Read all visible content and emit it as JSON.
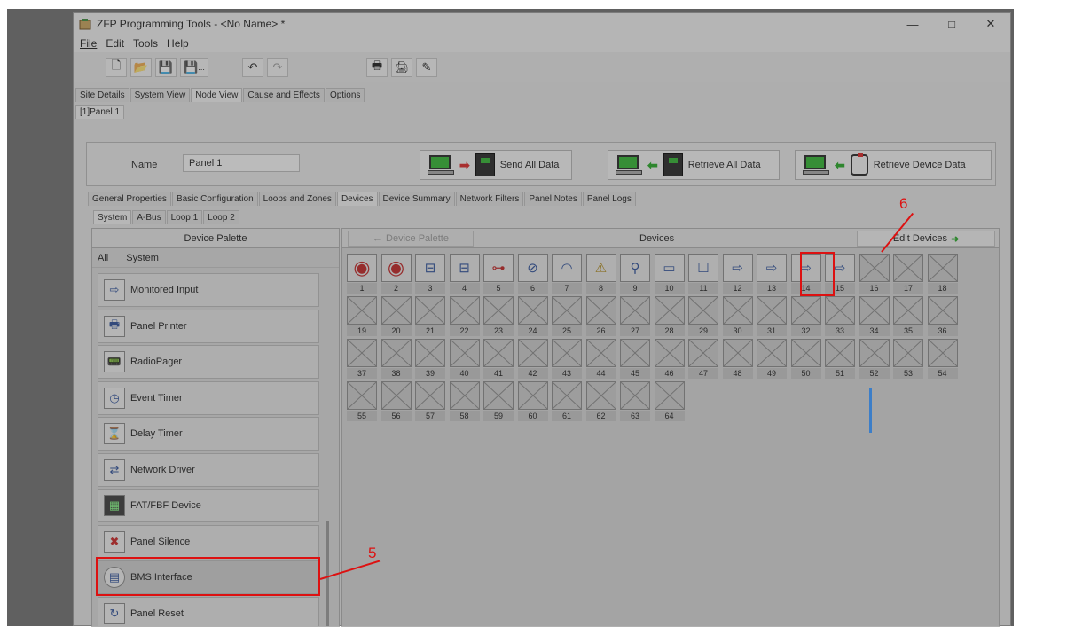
{
  "window": {
    "title": "ZFP Programming Tools - <No Name> *",
    "controls": {
      "minimize": "—",
      "maximize": "□",
      "close": "✕"
    }
  },
  "menu": [
    "File",
    "Edit",
    "Tools",
    "Help"
  ],
  "toolbar": {
    "icons": [
      "new-icon",
      "open-icon",
      "save-icon",
      "save-as-icon",
      "undo-icon",
      "redo-icon",
      "print-icon",
      "print-preview-icon",
      "print-setup-icon"
    ],
    "save_as_suffix": "..."
  },
  "main_tabs": [
    "Site Details",
    "System View",
    "Node View",
    "Cause and Effects",
    "Options"
  ],
  "node_tabs": [
    "[1]Panel 1"
  ],
  "name_bar": {
    "label": "Name",
    "value": "Panel 1",
    "send": "Send All Data",
    "retrieve_all": "Retrieve All Data",
    "retrieve_device": "Retrieve Device Data"
  },
  "sub_tabs": [
    "General Properties",
    "Basic Configuration",
    "Loops and Zones",
    "Devices",
    "Device Summary",
    "Network Filters",
    "Panel Notes",
    "Panel Logs"
  ],
  "sub_tabs2": [
    "System",
    "A-Bus",
    "Loop 1",
    "Loop 2"
  ],
  "palette": {
    "header": "Device Palette",
    "filters": [
      "All",
      "System"
    ],
    "items": [
      "Monitored Input",
      "Panel Printer",
      "RadioPager",
      "Event Timer",
      "Delay Timer",
      "Network Driver",
      "FAT/FBF Device",
      "Panel Silence",
      "BMS Interface",
      "Panel Reset"
    ]
  },
  "devices": {
    "back_label": "Device Palette",
    "title": "Devices",
    "edit_label": "Edit Devices",
    "filled": 15,
    "total": 64
  },
  "callouts": {
    "a": "6",
    "b": "5"
  },
  "colors": {
    "highlight": "#d11111",
    "accent_green": "#2fb62f"
  }
}
